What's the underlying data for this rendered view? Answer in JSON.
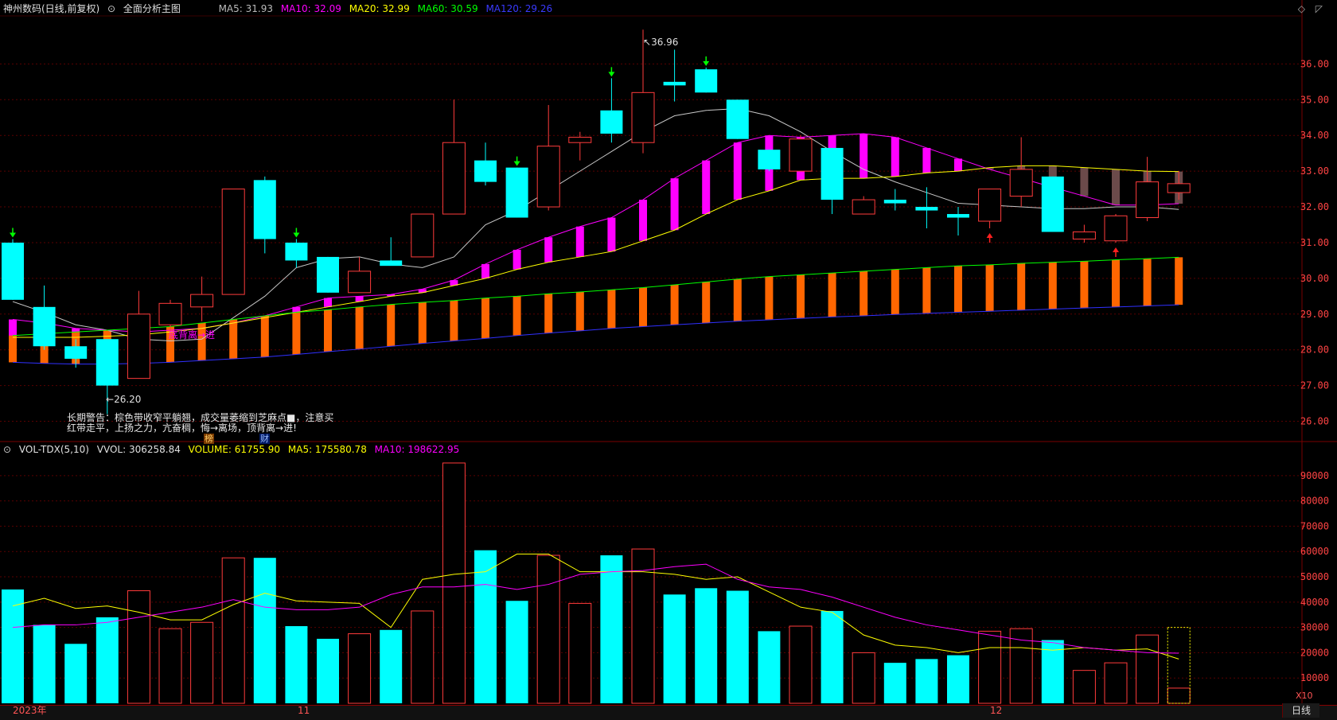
{
  "main_header": {
    "title": "神州数码(日线,前复权)",
    "indicator_name": "全面分析主图",
    "ma5": "MA5: 31.93",
    "ma10": "MA10: 32.09",
    "ma20": "MA20: 32.99",
    "ma60": "MA60: 30.59",
    "ma120": "MA120: 29.26"
  },
  "vol_header": {
    "name": "VOL-TDX(5,10)",
    "vvol": "VVOL: 306258.84",
    "volume": "VOLUME: 61755.90",
    "ma5": "MA5: 175580.78",
    "ma10": "MA10: 198622.95"
  },
  "annotations": {
    "high_label": "36.96",
    "low_label": "26.20",
    "comment": "长期警告：棕色带收窄平躺翘，成交量萎缩到芝麻点■，注意买\n红带走平，上扬之力，亢奋稠，悔→离场，顶背离→进!",
    "divergence": "底背离→进",
    "badge_1": "榜",
    "badge_2": "财"
  },
  "x_axis": {
    "labels": [
      "2023年",
      "11",
      "12"
    ]
  },
  "timeframe_tab": "日线",
  "vol_multiplier": "X10",
  "colors": {
    "up": "#ff3b3b",
    "down": "#00ffff",
    "grid": "#5a0000",
    "ma5": "#c8c8c8",
    "ma10": "#ff00ff",
    "ma20": "#ffff00",
    "ma60": "#00ff00",
    "ma120": "#3030ff",
    "band_magenta": "#ff00ff",
    "band_orange": "#ff6600",
    "band_brown": "#6b4a4a"
  },
  "chart_data": [
    {
      "type": "candlestick",
      "price_axis": [
        26.0,
        27.0,
        28.0,
        29.0,
        30.0,
        31.0,
        32.0,
        33.0,
        34.0,
        35.0,
        36.0
      ],
      "ylim": [
        25.5,
        37.3
      ],
      "candles": [
        {
          "o": 31.0,
          "h": 31.1,
          "l": 29.4,
          "c": 29.4
        },
        {
          "o": 29.2,
          "h": 29.8,
          "l": 28.0,
          "c": 28.1
        },
        {
          "o": 28.1,
          "h": 28.3,
          "l": 27.5,
          "c": 27.75
        },
        {
          "o": 28.3,
          "h": 28.3,
          "l": 26.2,
          "c": 27.0
        },
        {
          "o": 27.2,
          "h": 29.65,
          "l": 27.2,
          "c": 29.0
        },
        {
          "o": 28.7,
          "h": 29.4,
          "l": 28.5,
          "c": 29.3
        },
        {
          "o": 29.2,
          "h": 30.05,
          "l": 28.8,
          "c": 29.55
        },
        {
          "o": 29.55,
          "h": 32.5,
          "l": 29.55,
          "c": 32.5
        },
        {
          "o": 32.75,
          "h": 32.85,
          "l": 30.7,
          "c": 31.1
        },
        {
          "o": 31.0,
          "h": 31.1,
          "l": 30.3,
          "c": 30.5
        },
        {
          "o": 30.6,
          "h": 30.6,
          "l": 29.6,
          "c": 29.6
        },
        {
          "o": 29.6,
          "h": 30.6,
          "l": 29.6,
          "c": 30.2
        },
        {
          "o": 30.5,
          "h": 31.15,
          "l": 30.4,
          "c": 30.35
        },
        {
          "o": 30.6,
          "h": 31.8,
          "l": 30.6,
          "c": 31.8
        },
        {
          "o": 31.8,
          "h": 35.0,
          "l": 31.9,
          "c": 33.8
        },
        {
          "o": 33.3,
          "h": 33.8,
          "l": 32.6,
          "c": 32.7
        },
        {
          "o": 33.1,
          "h": 33.1,
          "l": 31.7,
          "c": 31.7
        },
        {
          "o": 32.0,
          "h": 34.85,
          "l": 31.9,
          "c": 33.7
        },
        {
          "o": 33.8,
          "h": 34.1,
          "l": 33.3,
          "c": 33.95
        },
        {
          "o": 34.7,
          "h": 35.6,
          "l": 33.8,
          "c": 34.05
        },
        {
          "o": 33.8,
          "h": 36.96,
          "l": 33.5,
          "c": 35.2
        },
        {
          "o": 35.5,
          "h": 36.4,
          "l": 34.95,
          "c": 35.4
        },
        {
          "o": 35.85,
          "h": 35.9,
          "l": 35.2,
          "c": 35.2
        },
        {
          "o": 35.0,
          "h": 35.0,
          "l": 33.9,
          "c": 33.9
        },
        {
          "o": 33.6,
          "h": 33.6,
          "l": 33.0,
          "c": 33.05
        },
        {
          "o": 33.0,
          "h": 34.0,
          "l": 33.0,
          "c": 33.9
        },
        {
          "o": 33.65,
          "h": 33.65,
          "l": 31.8,
          "c": 32.2
        },
        {
          "o": 31.8,
          "h": 32.3,
          "l": 31.8,
          "c": 32.2
        },
        {
          "o": 32.2,
          "h": 32.5,
          "l": 31.9,
          "c": 32.1
        },
        {
          "o": 32.0,
          "h": 32.55,
          "l": 31.4,
          "c": 31.9
        },
        {
          "o": 31.8,
          "h": 32.0,
          "l": 31.2,
          "c": 31.7
        },
        {
          "o": 31.6,
          "h": 32.5,
          "l": 31.4,
          "c": 32.5
        },
        {
          "o": 32.3,
          "h": 33.95,
          "l": 32.0,
          "c": 33.05
        },
        {
          "o": 32.85,
          "h": 32.85,
          "l": 31.3,
          "c": 31.3
        },
        {
          "o": 31.1,
          "h": 31.5,
          "l": 31.0,
          "c": 31.3
        },
        {
          "o": 31.05,
          "h": 31.8,
          "l": 31.0,
          "c": 31.75
        },
        {
          "o": 31.7,
          "h": 33.4,
          "l": 31.6,
          "c": 32.7
        },
        {
          "o": 32.4,
          "h": 33.0,
          "l": 32.2,
          "c": 32.65
        }
      ],
      "ma5": [
        29.35,
        29.05,
        28.7,
        28.55,
        28.3,
        28.25,
        28.3,
        28.9,
        29.5,
        30.3,
        30.55,
        30.6,
        30.4,
        30.3,
        30.6,
        31.5,
        31.9,
        32.45,
        33.0,
        33.55,
        34.1,
        34.55,
        34.7,
        34.75,
        34.55,
        34.1,
        33.55,
        33.05,
        32.7,
        32.4,
        32.1,
        32.05,
        32.0,
        31.95,
        31.95,
        32.0,
        32.0,
        31.93
      ],
      "ma10": [
        28.85,
        28.75,
        28.6,
        28.55,
        28.5,
        28.55,
        28.6,
        28.75,
        28.95,
        29.2,
        29.45,
        29.5,
        29.55,
        29.7,
        29.95,
        30.4,
        30.8,
        31.15,
        31.45,
        31.7,
        32.2,
        32.8,
        33.3,
        33.8,
        34.0,
        33.95,
        34.0,
        34.05,
        33.95,
        33.65,
        33.35,
        33.05,
        32.8,
        32.55,
        32.3,
        32.05,
        32.05,
        32.09
      ],
      "ma20": [
        28.35,
        28.35,
        28.35,
        28.38,
        28.42,
        28.5,
        28.6,
        28.75,
        28.9,
        29.05,
        29.2,
        29.35,
        29.5,
        29.6,
        29.8,
        30.0,
        30.25,
        30.45,
        30.6,
        30.75,
        31.05,
        31.35,
        31.8,
        32.2,
        32.45,
        32.75,
        32.8,
        32.8,
        32.85,
        32.95,
        33.0,
        33.1,
        33.15,
        33.15,
        33.1,
        33.05,
        33.0,
        32.99
      ],
      "ma60": [
        28.4,
        28.45,
        28.5,
        28.55,
        28.6,
        28.65,
        28.75,
        28.85,
        28.95,
        29.05,
        29.12,
        29.2,
        29.27,
        29.33,
        29.38,
        29.45,
        29.5,
        29.57,
        29.62,
        29.68,
        29.74,
        29.82,
        29.9,
        29.98,
        30.05,
        30.1,
        30.15,
        30.2,
        30.25,
        30.3,
        30.35,
        30.38,
        30.42,
        30.45,
        30.48,
        30.52,
        30.55,
        30.59
      ],
      "ma120": [
        27.65,
        27.62,
        27.6,
        27.6,
        27.62,
        27.65,
        27.7,
        27.75,
        27.8,
        27.87,
        27.95,
        28.02,
        28.1,
        28.18,
        28.25,
        28.32,
        28.4,
        28.47,
        28.53,
        28.6,
        28.65,
        28.7,
        28.75,
        28.8,
        28.84,
        28.88,
        28.92,
        28.95,
        28.99,
        29.02,
        29.05,
        29.08,
        29.11,
        29.14,
        29.17,
        29.2,
        29.23,
        29.26
      ],
      "down_arrows_at": [
        0,
        9,
        16,
        19,
        22
      ],
      "up_arrows_at": [
        31,
        35
      ]
    },
    {
      "type": "bar",
      "title": "VOL-TDX(5,10)",
      "yticks": [
        10000,
        20000,
        30000,
        40000,
        50000,
        60000,
        70000,
        80000,
        90000
      ],
      "ylim": [
        0,
        97500
      ],
      "volumes": [
        45000,
        31000,
        23500,
        34000,
        44500,
        29500,
        32000,
        57500,
        57500,
        30500,
        25500,
        27500,
        29000,
        36500,
        95000,
        60500,
        40500,
        58500,
        39500,
        58500,
        61000,
        43000,
        45500,
        44500,
        28500,
        30500,
        36500,
        20000,
        16000,
        17500,
        19000,
        28500,
        29500,
        25000,
        13000,
        16000,
        27000,
        6000
      ],
      "vol_ma5": [
        38500,
        41500,
        37500,
        38500,
        36000,
        33000,
        33000,
        39000,
        43500,
        40500,
        40000,
        39500,
        30000,
        49000,
        51000,
        52000,
        59000,
        59000,
        52000,
        52000,
        52000,
        51000,
        49000,
        50000,
        44000,
        38000,
        36000,
        27000,
        23000,
        22000,
        20000,
        22000,
        22000,
        21000,
        22000,
        21000,
        21500,
        17500
      ],
      "vol_ma10": [
        30000,
        31000,
        31000,
        32000,
        34000,
        36000,
        38000,
        41000,
        38000,
        37000,
        37000,
        38000,
        43000,
        46000,
        46000,
        47000,
        45000,
        47000,
        51000,
        52000,
        52500,
        54000,
        55000,
        49000,
        46000,
        45000,
        42000,
        38000,
        34000,
        31000,
        29000,
        27000,
        25000,
        24000,
        22000,
        21000,
        20000,
        19800
      ],
      "current_outline_value": 30000
    }
  ]
}
